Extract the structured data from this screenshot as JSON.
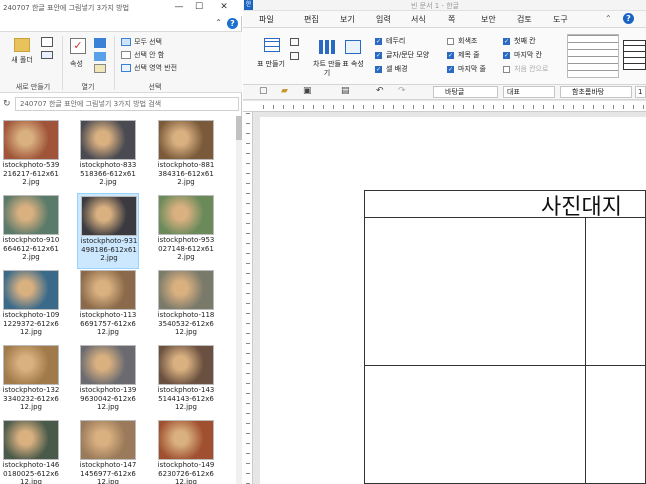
{
  "explorer": {
    "title": "240707 한글 표안에 그림넣기 3가지 방법",
    "ribbon": {
      "group_new": {
        "button": "새 폴더",
        "label": "새로 만들기"
      },
      "group_open": {
        "button": "속성",
        "label": "열기"
      },
      "group_select": {
        "items": [
          "모두 선택",
          "선택 안 함",
          "선택 영역 반전"
        ],
        "label": "선택"
      }
    },
    "address": "240707 한글 표안에 그림넣기 3가지 방법 검색",
    "files": [
      {
        "name": "istockphoto-539216217-612x612.jpg",
        "color": "#a0553a"
      },
      {
        "name": "istockphoto-833518366-612x612.jpg",
        "color": "#4a4a52"
      },
      {
        "name": "istockphoto-881384316-612x612.jpg",
        "color": "#7a5a3a"
      },
      {
        "name": "istockphoto-910664612-612x612.jpg",
        "color": "#5a7a6a"
      },
      {
        "name": "istockphoto-931498186-612x612.jpg",
        "color": "#3a3a40"
      },
      {
        "name": "istockphoto-953027148-612x612.jpg",
        "color": "#6a8a5a"
      },
      {
        "name": "istockphoto-1091229372-612x612.jpg",
        "color": "#3a6a8a"
      },
      {
        "name": "istockphoto-1136691757-612x612.jpg",
        "color": "#8a6a4a"
      },
      {
        "name": "istockphoto-1183540532-612x612.jpg",
        "color": "#7a7a6a"
      },
      {
        "name": "istockphoto-1323340232-612x612.jpg",
        "color": "#a07a4a"
      },
      {
        "name": "istockphoto-1399630042-612x612.jpg",
        "color": "#6a6a70"
      },
      {
        "name": "istockphoto-1435144143-612x612.jpg",
        "color": "#6a5040"
      },
      {
        "name": "istockphoto-1460180025-612x612.jpg",
        "color": "#4a5a4a"
      },
      {
        "name": "istockphoto-1471456977-612x612.jpg",
        "color": "#9a7a5a"
      },
      {
        "name": "istockphoto-1496230726-612x612.jpg",
        "color": "#a05030"
      }
    ],
    "selected_index": 4
  },
  "hwp": {
    "title": "빈 문서 1 - 한글",
    "menu": [
      "파일",
      "편집",
      "보기",
      "입력",
      "서식",
      "쪽",
      "보안",
      "검토",
      "도구"
    ],
    "ribbon": {
      "table_btn": "표 만들기",
      "chart_btn": "차트 만들기",
      "edit_btn": "표 속성",
      "checks": [
        {
          "label": "테두리",
          "on": true
        },
        {
          "label": "글자/문단 모양",
          "on": true
        },
        {
          "label": "셀 배경",
          "on": true
        },
        {
          "label": "회색조",
          "on": false
        },
        {
          "label": "제목 줄",
          "on": true
        },
        {
          "label": "마지막 줄",
          "on": true
        },
        {
          "label": "첫째 칸",
          "on": true
        },
        {
          "label": "마지막 칸",
          "on": true
        },
        {
          "label": "처음 칸으로",
          "on": false
        }
      ]
    },
    "toolbar": {
      "style": "바탕글",
      "lang": "대표",
      "font": "함초롬바탕",
      "size": "1"
    },
    "document": {
      "title": "사진대지"
    }
  },
  "colors": {
    "accent": "#1b64c2",
    "selection": "#cce8ff"
  }
}
